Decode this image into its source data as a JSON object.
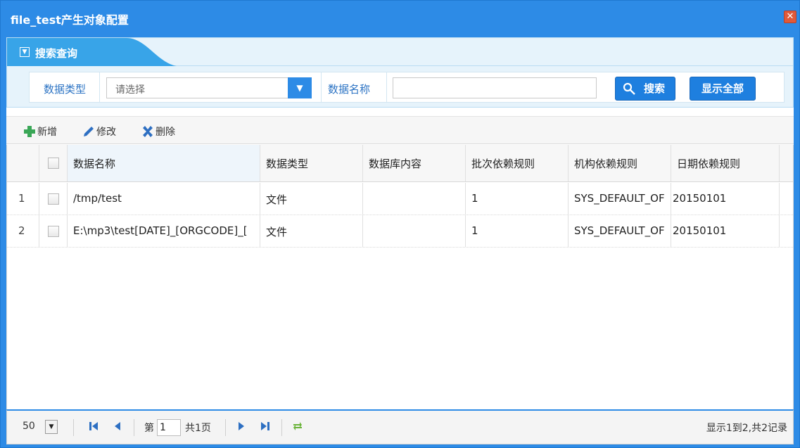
{
  "window": {
    "title": "file_test产生对象配置",
    "close_label": "✕"
  },
  "search": {
    "title": "搜索查询",
    "data_type_label": "数据类型",
    "data_type_select": "请选择",
    "data_name_label": "数据名称",
    "data_name_value": "",
    "search_button": "搜索",
    "show_all_button": "显示全部"
  },
  "toolbar": {
    "add_label": "新增",
    "edit_label": "修改",
    "delete_label": "删除"
  },
  "grid": {
    "columns": [
      "数据名称",
      "数据类型",
      "数据库内容",
      "批次依赖规则",
      "机构依赖规则",
      "日期依赖规则"
    ],
    "rows": [
      {
        "num": "1",
        "name": "/tmp/test",
        "type": "文件",
        "db": "",
        "batch": "1",
        "org": "SYS_DEFAULT_OF",
        "date": "20150101"
      },
      {
        "num": "2",
        "name": "E:\\mp3\\test[DATE]_[ORGCODE]_[",
        "type": "文件",
        "db": "",
        "batch": "1",
        "org": "SYS_DEFAULT_OF",
        "date": "20150101"
      }
    ]
  },
  "pager": {
    "page_size": "50",
    "page_prefix": "第",
    "page_value": "1",
    "page_total": "共1页",
    "summary": "显示1到2,共2记录"
  },
  "colors": {
    "brand_blue": "#2d8be6",
    "label_blue": "#2d74c4",
    "add_green": "#3aa757",
    "delete_blue": "#2d6fc2"
  }
}
